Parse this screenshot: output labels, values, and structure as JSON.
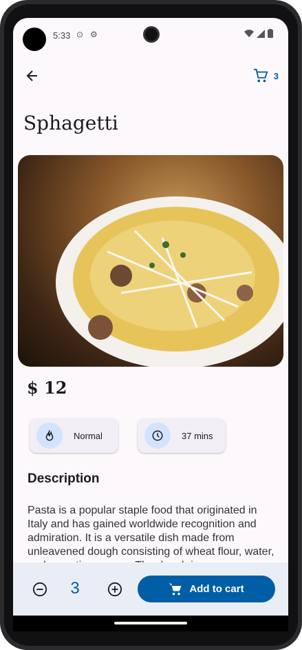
{
  "status_bar": {
    "time": "5:33"
  },
  "app_bar": {
    "cart_count": "3"
  },
  "product": {
    "title": "Sphagetti",
    "price": "$ 12",
    "spice_level": "Normal",
    "cook_time": "37 mins"
  },
  "description": {
    "heading": "Description",
    "text": "Pasta is a popular staple food that originated in Italy and has gained worldwide recognition and admiration. It is a versatile dish made from unleavened dough consisting of wheat flour, water, and sometimes eggs. The dough is"
  },
  "cart_bar": {
    "quantity": "3",
    "add_label": "Add to cart"
  },
  "colors": {
    "accent": "#005ea6",
    "chip_icon_bg": "#d3e3fd",
    "bottom_bar": "#e9eef6"
  },
  "icons": [
    "back-arrow-icon",
    "cart-icon",
    "fire-icon",
    "clock-icon",
    "minus-circle-icon",
    "plus-circle-icon"
  ]
}
